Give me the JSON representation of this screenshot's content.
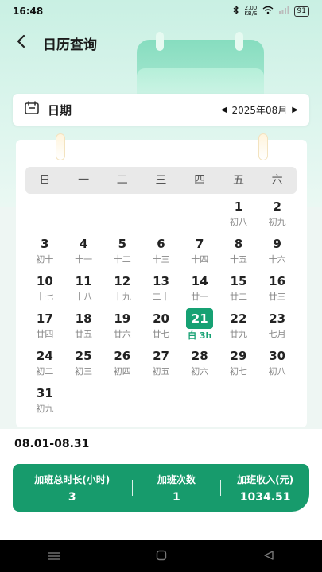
{
  "status": {
    "time": "16:48",
    "net_speed": "2.00\nKB/S",
    "battery": "91"
  },
  "header": {
    "title": "日历查询"
  },
  "date_bar": {
    "label": "日期",
    "month": "2025年08月"
  },
  "weekdays": [
    "日",
    "一",
    "二",
    "三",
    "四",
    "五",
    "六"
  ],
  "calendar": [
    [
      {
        "d": "",
        "l": ""
      },
      {
        "d": "",
        "l": ""
      },
      {
        "d": "",
        "l": ""
      },
      {
        "d": "",
        "l": ""
      },
      {
        "d": "",
        "l": ""
      },
      {
        "d": "1",
        "l": "初八"
      },
      {
        "d": "2",
        "l": "初九"
      }
    ],
    [
      {
        "d": "3",
        "l": "初十"
      },
      {
        "d": "4",
        "l": "十一"
      },
      {
        "d": "5",
        "l": "十二"
      },
      {
        "d": "6",
        "l": "十三"
      },
      {
        "d": "7",
        "l": "十四"
      },
      {
        "d": "8",
        "l": "十五"
      },
      {
        "d": "9",
        "l": "十六"
      }
    ],
    [
      {
        "d": "10",
        "l": "十七"
      },
      {
        "d": "11",
        "l": "十八"
      },
      {
        "d": "12",
        "l": "十九"
      },
      {
        "d": "13",
        "l": "二十"
      },
      {
        "d": "14",
        "l": "廿一"
      },
      {
        "d": "15",
        "l": "廿二"
      },
      {
        "d": "16",
        "l": "廿三"
      }
    ],
    [
      {
        "d": "17",
        "l": "廿四"
      },
      {
        "d": "18",
        "l": "廿五"
      },
      {
        "d": "19",
        "l": "廿六"
      },
      {
        "d": "20",
        "l": "廿七"
      },
      {
        "d": "21",
        "l": "白 3h",
        "selected": true
      },
      {
        "d": "22",
        "l": "廿九"
      },
      {
        "d": "23",
        "l": "七月"
      }
    ],
    [
      {
        "d": "24",
        "l": "初二"
      },
      {
        "d": "25",
        "l": "初三"
      },
      {
        "d": "26",
        "l": "初四"
      },
      {
        "d": "27",
        "l": "初五"
      },
      {
        "d": "28",
        "l": "初六"
      },
      {
        "d": "29",
        "l": "初七"
      },
      {
        "d": "30",
        "l": "初八"
      }
    ],
    [
      {
        "d": "31",
        "l": "初九"
      },
      {
        "d": "",
        "l": ""
      },
      {
        "d": "",
        "l": ""
      },
      {
        "d": "",
        "l": ""
      },
      {
        "d": "",
        "l": ""
      },
      {
        "d": "",
        "l": ""
      },
      {
        "d": "",
        "l": ""
      }
    ]
  ],
  "range_label": "08.01-08.31",
  "summary": [
    {
      "label": "加班总时长(小时)",
      "value": "3"
    },
    {
      "label": "加班次数",
      "value": "1"
    },
    {
      "label": "加班收入(元)",
      "value": "1034.51"
    }
  ],
  "icons": {
    "back": "back-arrow-icon",
    "calendar": "calendar-icon",
    "prev": "triangle-left-icon",
    "next": "triangle-right-icon"
  },
  "colors": {
    "accent": "#16a173",
    "summary_bg": "#179b6c",
    "header_bg": "#c9f0e3"
  }
}
